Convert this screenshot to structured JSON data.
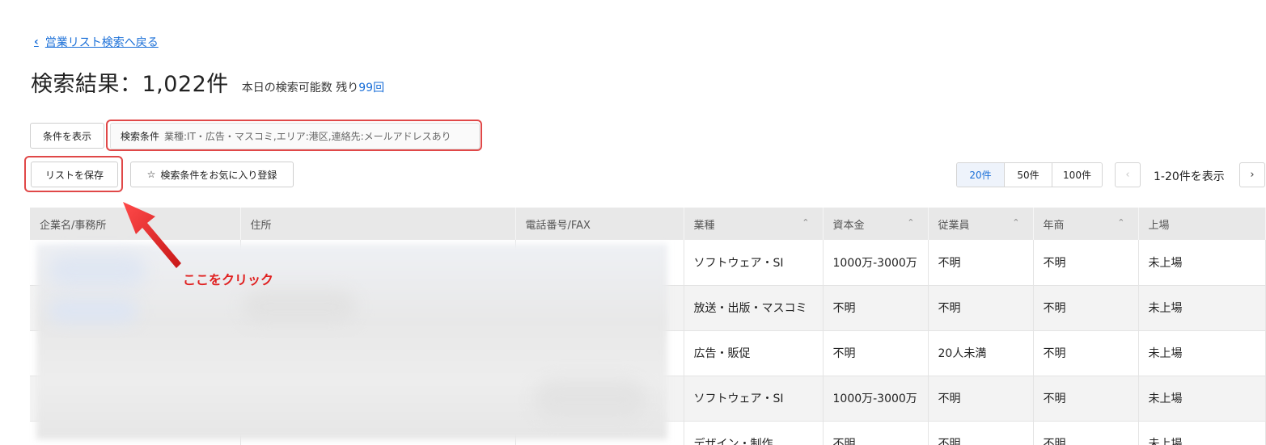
{
  "nav": {
    "back_label": "営業リスト検索へ戻る"
  },
  "header": {
    "title": "検索結果：1,022件",
    "remaining_prefix": "本日の検索可能数 残り",
    "remaining_count": "99回"
  },
  "toolbar": {
    "show_conditions_label": "条件を表示",
    "conditions_label": "検索条件",
    "conditions_value": "業種:IT・広告・マスコミ,エリア:港区,連絡先:メールアドレスあり",
    "save_list_label": "リストを保存",
    "favorite_label": "検索条件をお気に入り登録"
  },
  "pagination": {
    "per_page_options": [
      "20件",
      "50件",
      "100件"
    ],
    "selected": "20件",
    "range_text": "1-20件を表示"
  },
  "table": {
    "columns": [
      "企業名/事務所",
      "住所",
      "電話番号/FAX",
      "業種",
      "資本金",
      "従業員",
      "年商",
      "上場"
    ],
    "rows": [
      [
        "",
        "",
        "",
        "ソフトウェア・SI",
        "1000万-3000万",
        "不明",
        "不明",
        "未上場"
      ],
      [
        "",
        "",
        "",
        "放送・出版・マスコミ",
        "不明",
        "不明",
        "不明",
        "未上場"
      ],
      [
        "",
        "",
        "",
        "広告・販促",
        "不明",
        "20人未満",
        "不明",
        "未上場"
      ],
      [
        "",
        "",
        "",
        "ソフトウェア・SI",
        "1000万-3000万",
        "不明",
        "不明",
        "未上場"
      ],
      [
        "",
        "",
        "",
        "デザイン・制作",
        "不明",
        "不明",
        "不明",
        "未上場"
      ]
    ]
  },
  "annotation": {
    "click_here": "ここをクリック"
  },
  "colors": {
    "accent": "#1a6fd8",
    "highlight": "#e04848",
    "header_bg": "#e8e8e8"
  }
}
